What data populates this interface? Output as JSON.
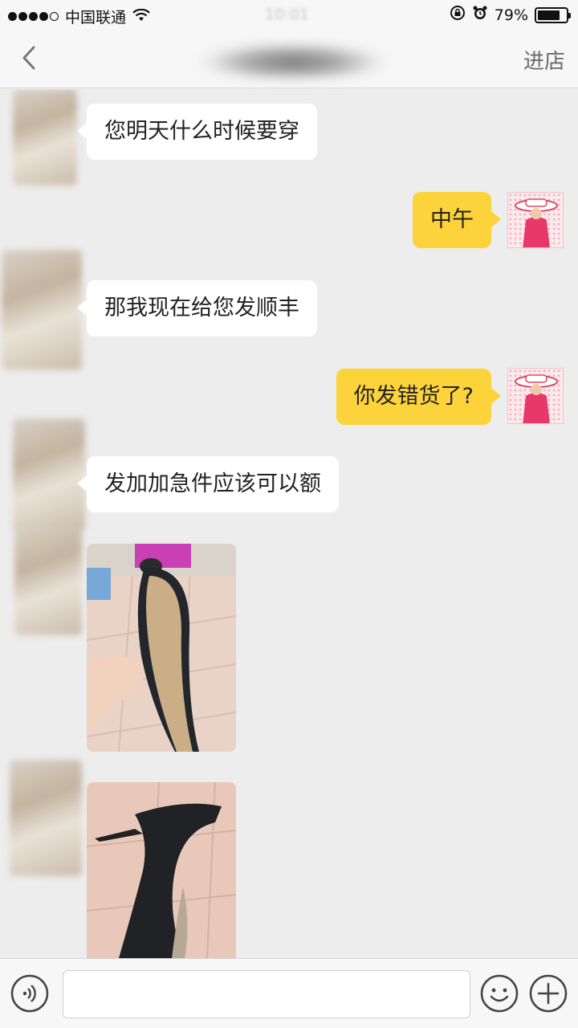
{
  "status_bar": {
    "carrier": "中国联通",
    "time": "10:01",
    "battery_percent": "79%",
    "battery_level": 0.79,
    "signal_bars_filled": 4,
    "signal_bars_total": 5
  },
  "nav": {
    "back_icon": "chevron-left-icon",
    "enter_shop_label": "进店"
  },
  "messages": [
    {
      "side": "left",
      "type": "text",
      "text": "您明天什么时候要穿"
    },
    {
      "side": "right",
      "type": "text",
      "text": "中午"
    },
    {
      "side": "left",
      "type": "text",
      "text": "那我现在给您发顺丰"
    },
    {
      "side": "right",
      "type": "text",
      "text": "你发错货了?"
    },
    {
      "side": "left",
      "type": "text",
      "text": "发加加急件应该可以额"
    },
    {
      "side": "left",
      "type": "image",
      "subject": "shoe-sole-photo"
    },
    {
      "side": "left",
      "type": "image",
      "subject": "black-high-heel-photo"
    }
  ],
  "input_bar": {
    "voice_icon": "voice-icon",
    "emoji_icon": "emoji-icon",
    "plus_icon": "plus-icon",
    "input_value": ""
  },
  "colors": {
    "background": "#ededed",
    "bubble_incoming": "#ffffff",
    "bubble_outgoing": "#fcd33a",
    "bar": "#f7f7f7"
  }
}
